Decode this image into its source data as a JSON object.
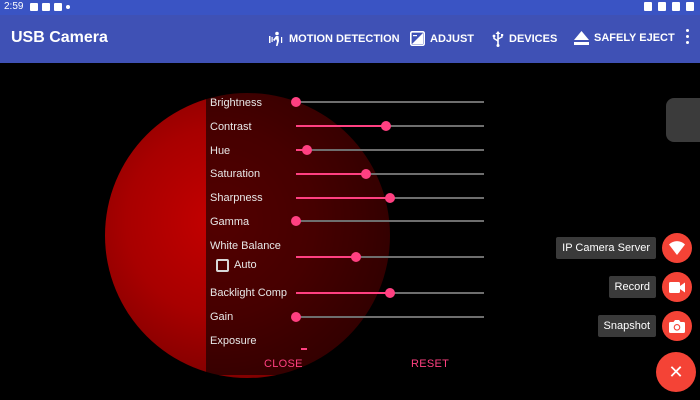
{
  "status_bar": {
    "time": "2:59"
  },
  "app_bar": {
    "title": "USB Camera",
    "actions": [
      {
        "label": "MOTION DETECTION",
        "icon": "motion-icon"
      },
      {
        "label": "ADJUST",
        "icon": "adjust-icon"
      },
      {
        "label": "DEVICES",
        "icon": "usb-icon"
      },
      {
        "label": "SAFELY EJECT",
        "icon": "eject-icon"
      }
    ],
    "overflow_icon": "more-vert-icon"
  },
  "adjust_panel": {
    "sliders": [
      {
        "label": "Brightness",
        "value": 0.0
      },
      {
        "label": "Contrast",
        "value": 0.48
      },
      {
        "label": "Hue",
        "value": 0.06
      },
      {
        "label": "Saturation",
        "value": 0.37
      },
      {
        "label": "Sharpness",
        "value": 0.5
      },
      {
        "label": "Gamma",
        "value": 0.0
      },
      {
        "label": "White Balance",
        "value": 0.32
      },
      {
        "label": "Backlight Comp",
        "value": 0.5
      },
      {
        "label": "Gain",
        "value": 0.0
      }
    ],
    "exposure_label": "Exposure",
    "auto_label": "Auto",
    "auto_checked": false,
    "close_label": "CLOSE",
    "reset_label": "RESET"
  },
  "fab_menu": {
    "items": [
      {
        "label": "IP Camera Server",
        "icon": "wifi-icon"
      },
      {
        "label": "Record",
        "icon": "videocam-icon"
      },
      {
        "label": "Snapshot",
        "icon": "camera-icon"
      }
    ],
    "close_icon": "close-icon",
    "close_glyph": "✕"
  },
  "colors": {
    "app_bar": "#3f51b5",
    "accent": "#ff4081",
    "fab": "#f44336"
  }
}
